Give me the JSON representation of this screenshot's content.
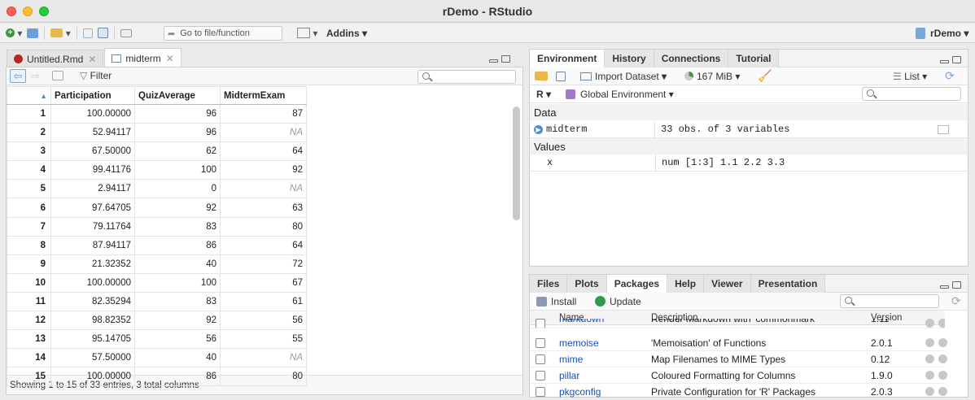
{
  "window": {
    "title": "rDemo - RStudio"
  },
  "toolbar": {
    "goto_placeholder": "Go to file/function",
    "addins": "Addins",
    "project": "rDemo"
  },
  "source": {
    "tabs": [
      {
        "label": "Untitled.Rmd"
      },
      {
        "label": "midterm"
      }
    ],
    "filter_label": "Filter",
    "columns": [
      "Participation",
      "QuizAverage",
      "MidtermExam"
    ],
    "rows": [
      [
        "1",
        "100.00000",
        "96",
        "87"
      ],
      [
        "2",
        "52.94117",
        "96",
        "NA"
      ],
      [
        "3",
        "67.50000",
        "62",
        "64"
      ],
      [
        "4",
        "99.41176",
        "100",
        "92"
      ],
      [
        "5",
        "2.94117",
        "0",
        "NA"
      ],
      [
        "6",
        "97.64705",
        "92",
        "63"
      ],
      [
        "7",
        "79.11764",
        "83",
        "80"
      ],
      [
        "8",
        "87.94117",
        "86",
        "64"
      ],
      [
        "9",
        "21.32352",
        "40",
        "72"
      ],
      [
        "10",
        "100.00000",
        "100",
        "67"
      ],
      [
        "11",
        "82.35294",
        "83",
        "61"
      ],
      [
        "12",
        "98.82352",
        "92",
        "56"
      ],
      [
        "13",
        "95.14705",
        "56",
        "55"
      ],
      [
        "14",
        "57.50000",
        "40",
        "NA"
      ],
      [
        "15",
        "100.00000",
        "86",
        "80"
      ]
    ],
    "status": "Showing 1 to 15 of 33 entries, 3 total columns"
  },
  "env": {
    "tabs": [
      "Environment",
      "History",
      "Connections",
      "Tutorial"
    ],
    "import_label": "Import Dataset",
    "memory": "167 MiB",
    "list_label": "List",
    "lang": "R",
    "scope": "Global Environment",
    "data_header": "Data",
    "data_row": {
      "name": "midterm",
      "value": "33 obs. of 3 variables"
    },
    "values_header": "Values",
    "values_row": {
      "name": "x",
      "value": "num [1:3] 1.1 2.2 3.3"
    }
  },
  "files": {
    "tabs": [
      "Files",
      "Plots",
      "Packages",
      "Help",
      "Viewer",
      "Presentation"
    ],
    "install_label": "Install",
    "update_label": "Update",
    "columns": [
      "Name",
      "Description",
      "Version"
    ],
    "packages": [
      {
        "name": "markdown",
        "desc": "Render Markdown with 'commonmark'",
        "ver": "1.11"
      },
      {
        "name": "memoise",
        "desc": "'Memoisation' of Functions",
        "ver": "2.0.1"
      },
      {
        "name": "mime",
        "desc": "Map Filenames to MIME Types",
        "ver": "0.12"
      },
      {
        "name": "pillar",
        "desc": "Coloured Formatting for Columns",
        "ver": "1.9.0"
      },
      {
        "name": "pkgconfig",
        "desc": "Private Configuration for 'R' Packages",
        "ver": "2.0.3"
      }
    ]
  },
  "colors": {
    "accent": "#1a4fb0",
    "na": "#999999"
  }
}
